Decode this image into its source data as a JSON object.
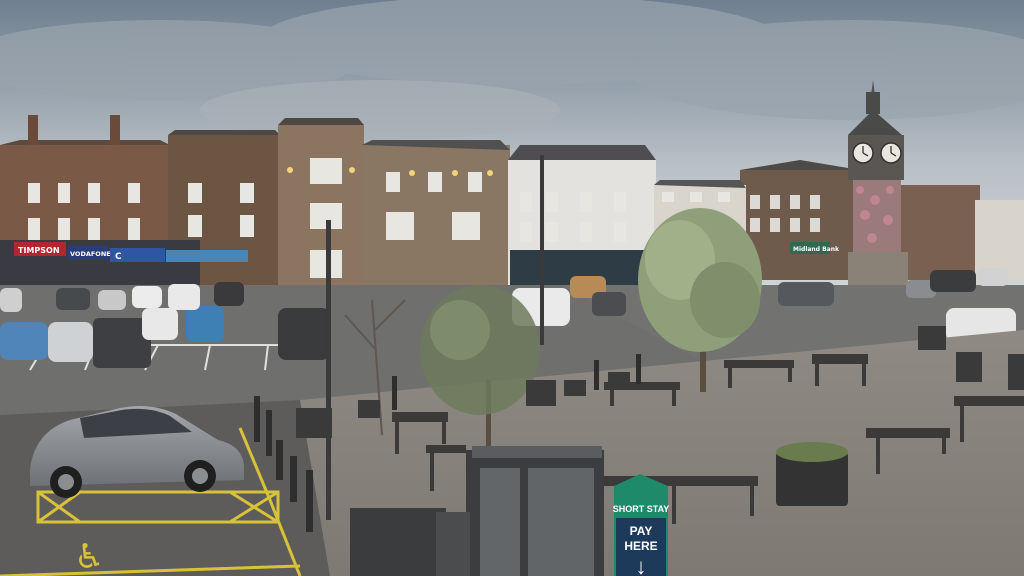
{
  "scene": {
    "description_shown": false,
    "colors": {
      "sky_top": "#7d8b99",
      "sky_bottom": "#c9cdd0",
      "brick": "#7a5a47",
      "paving": "#8c8780",
      "tarmac": "#6f6f6d",
      "road_line_yellow": "#d7c23a",
      "sign_green": "#1f8a6a",
      "car_silver": "#8d9196"
    },
    "shop_signs": {
      "timpson": "TIMPSON",
      "vodafone": "VODAFONE",
      "second_shop": "C",
      "right_shop": "Midland Bank"
    },
    "parking_sign": {
      "line1": "SHORT STAY",
      "line2": "PAY",
      "line3": "HERE",
      "arrow": "↓"
    },
    "icons": {
      "clock": "clock-icon",
      "arrow": "down-arrow-icon",
      "disabled": "wheelchair-icon"
    }
  }
}
